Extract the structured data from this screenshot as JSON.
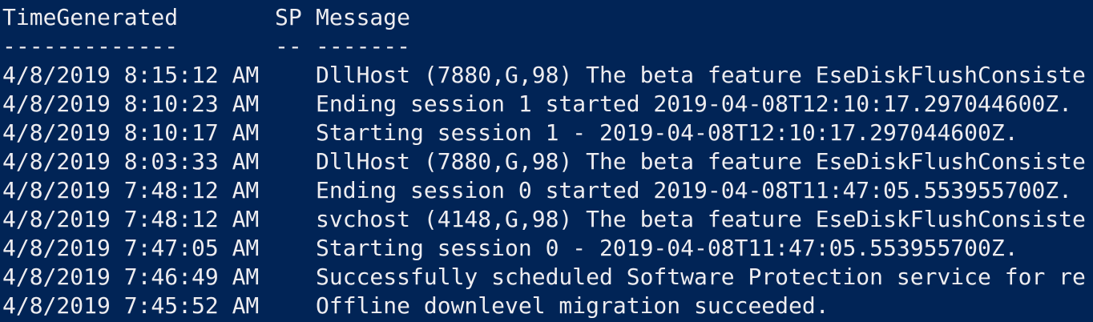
{
  "colors": {
    "background": "#012456",
    "foreground": "#eeedf0"
  },
  "headers": {
    "time": "TimeGenerated",
    "sp": "SP",
    "message": "Message"
  },
  "separators": {
    "time": "-------------",
    "sp": "--",
    "message": "-------"
  },
  "rows": [
    {
      "time": "4/8/2019 8:15:12 AM",
      "sp": "",
      "message": "DllHost (7880,G,98) The beta feature EseDiskFlushConsiste"
    },
    {
      "time": "4/8/2019 8:10:23 AM",
      "sp": "",
      "message": "Ending session 1 started 2019-04-08T12:10:17.297044600Z."
    },
    {
      "time": "4/8/2019 8:10:17 AM",
      "sp": "",
      "message": "Starting session 1 - 2019-04-08T12:10:17.297044600Z."
    },
    {
      "time": "4/8/2019 8:03:33 AM",
      "sp": "",
      "message": "DllHost (7880,G,98) The beta feature EseDiskFlushConsiste"
    },
    {
      "time": "4/8/2019 7:48:12 AM",
      "sp": "",
      "message": "Ending session 0 started 2019-04-08T11:47:05.553955700Z."
    },
    {
      "time": "4/8/2019 7:48:12 AM",
      "sp": "",
      "message": "svchost (4148,G,98) The beta feature EseDiskFlushConsiste"
    },
    {
      "time": "4/8/2019 7:47:05 AM",
      "sp": "",
      "message": "Starting session 0 - 2019-04-08T11:47:05.553955700Z."
    },
    {
      "time": "4/8/2019 7:46:49 AM",
      "sp": "",
      "message": "Successfully scheduled Software Protection service for re"
    },
    {
      "time": "4/8/2019 7:45:52 AM",
      "sp": "",
      "message": "Offline downlevel migration succeeded."
    }
  ]
}
